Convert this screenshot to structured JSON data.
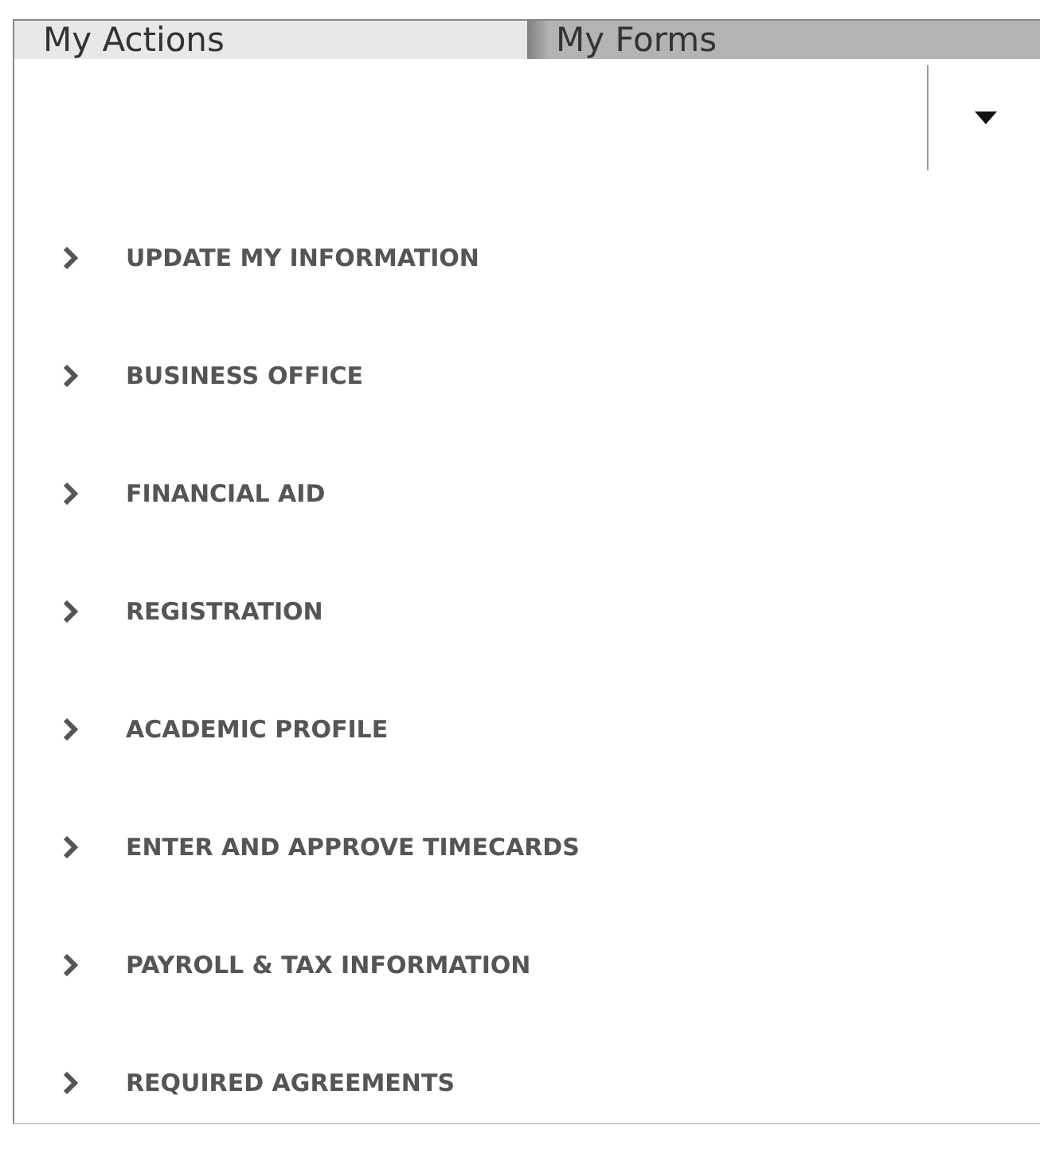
{
  "tabs": [
    {
      "label": "My Actions",
      "selected": true
    },
    {
      "label": "My Forms",
      "selected": false
    }
  ],
  "items": [
    {
      "label": "UPDATE MY INFORMATION"
    },
    {
      "label": "BUSINESS OFFICE"
    },
    {
      "label": "FINANCIAL AID"
    },
    {
      "label": "REGISTRATION"
    },
    {
      "label": "ACADEMIC PROFILE"
    },
    {
      "label": "ENTER AND APPROVE TIMECARDS"
    },
    {
      "label": "PAYROLL & TAX INFORMATION"
    },
    {
      "label": "REQUIRED AGREEMENTS"
    }
  ]
}
